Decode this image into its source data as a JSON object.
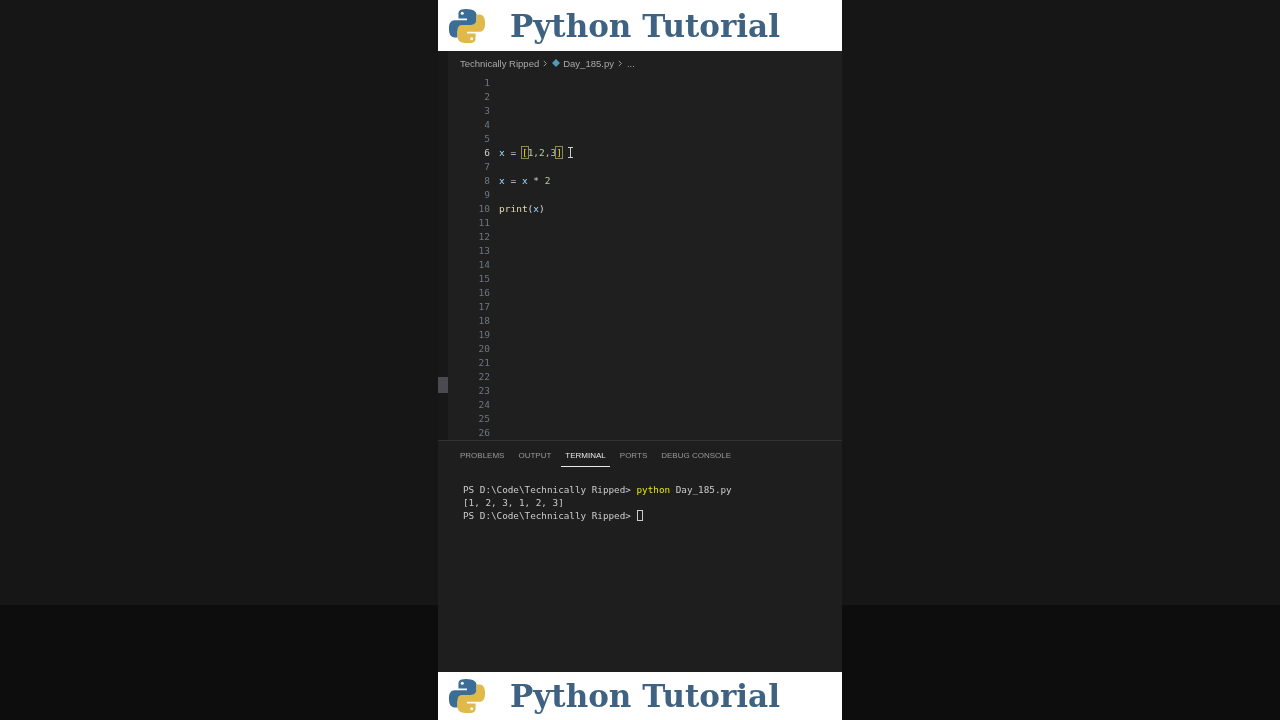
{
  "header_banner": {
    "title": "Python Tutorial"
  },
  "breadcrumb": [
    {
      "label": "Technically Ripped",
      "kind": "folder"
    },
    {
      "label": "Day_185.py",
      "kind": "file"
    },
    {
      "label": "...",
      "kind": "symbol"
    }
  ],
  "editor": {
    "lines": [
      {
        "number": "1",
        "current": false,
        "mouse_cursor": false
      },
      {
        "number": "2",
        "current": false,
        "mouse_cursor": false
      },
      {
        "number": "3",
        "current": false,
        "mouse_cursor": false
      },
      {
        "number": "4",
        "current": false,
        "mouse_cursor": false
      },
      {
        "number": "5",
        "current": false,
        "mouse_cursor": false
      },
      {
        "number": "6",
        "tokens": [
          {
            "text": "x",
            "kind": "var"
          },
          {
            "text": " = ",
            "kind": "op"
          },
          {
            "text": "[",
            "kind": "bracket"
          },
          {
            "text": "1,2,3",
            "kind": "num"
          },
          {
            "text": "]",
            "kind": "bracket"
          }
        ],
        "current": true,
        "mouse_cursor": true
      },
      {
        "number": "7",
        "current": false,
        "mouse_cursor": false
      },
      {
        "number": "8",
        "tokens": [
          {
            "text": "x",
            "kind": "var"
          },
          {
            "text": " = ",
            "kind": "op"
          },
          {
            "text": "x",
            "kind": "var"
          },
          {
            "text": " * ",
            "kind": "op"
          },
          {
            "text": "2",
            "kind": "num"
          }
        ],
        "current": false,
        "mouse_cursor": false
      },
      {
        "number": "9",
        "current": false,
        "mouse_cursor": false
      },
      {
        "number": "10",
        "tokens": [
          {
            "text": "print",
            "kind": "func"
          },
          {
            "text": "(",
            "kind": "op"
          },
          {
            "text": "x",
            "kind": "var"
          },
          {
            "text": ")",
            "kind": "op"
          }
        ],
        "current": false,
        "mouse_cursor": false
      },
      {
        "number": "11",
        "current": false,
        "mouse_cursor": false
      },
      {
        "number": "12",
        "current": false,
        "mouse_cursor": false
      },
      {
        "number": "13",
        "current": false,
        "mouse_cursor": false
      },
      {
        "number": "14",
        "current": false,
        "mouse_cursor": false
      },
      {
        "number": "15",
        "current": false,
        "mouse_cursor": false
      },
      {
        "number": "16",
        "current": false,
        "mouse_cursor": false
      },
      {
        "number": "17",
        "current": false,
        "mouse_cursor": false
      },
      {
        "number": "18",
        "current": false,
        "mouse_cursor": false
      },
      {
        "number": "19",
        "current": false,
        "mouse_cursor": false
      },
      {
        "number": "20",
        "current": false,
        "mouse_cursor": false
      },
      {
        "number": "21",
        "current": false,
        "mouse_cursor": false
      },
      {
        "number": "22",
        "current": false,
        "mouse_cursor": false
      },
      {
        "number": "23",
        "current": false,
        "mouse_cursor": false
      },
      {
        "number": "24",
        "current": false,
        "mouse_cursor": false
      },
      {
        "number": "25",
        "current": false,
        "mouse_cursor": false
      },
      {
        "number": "26",
        "current": false,
        "mouse_cursor": false
      }
    ]
  },
  "panel_tabs": [
    {
      "label": "PROBLEMS",
      "selected": false
    },
    {
      "label": "OUTPUT",
      "selected": false
    },
    {
      "label": "TERMINAL",
      "selected": true
    },
    {
      "label": "PORTS",
      "selected": false
    },
    {
      "label": "DEBUG CONSOLE",
      "selected": false
    }
  ],
  "terminal": {
    "lines": [
      {
        "tokens": [
          {
            "text": "PS D:\\Code\\Technically Ripped> ",
            "kind": "plain"
          },
          {
            "text": "python",
            "kind": "command"
          },
          {
            "text": " Day_185.py",
            "kind": "plain"
          }
        ],
        "cursor": false
      },
      {
        "tokens": [
          {
            "text": "[1, 2, 3, 1, 2, 3]",
            "kind": "plain"
          }
        ],
        "cursor": false
      },
      {
        "tokens": [
          {
            "text": "PS D:\\Code\\Technically Ripped> ",
            "kind": "plain"
          }
        ],
        "cursor": true
      }
    ]
  },
  "footer_banner": {
    "title": "Python Tutorial"
  }
}
